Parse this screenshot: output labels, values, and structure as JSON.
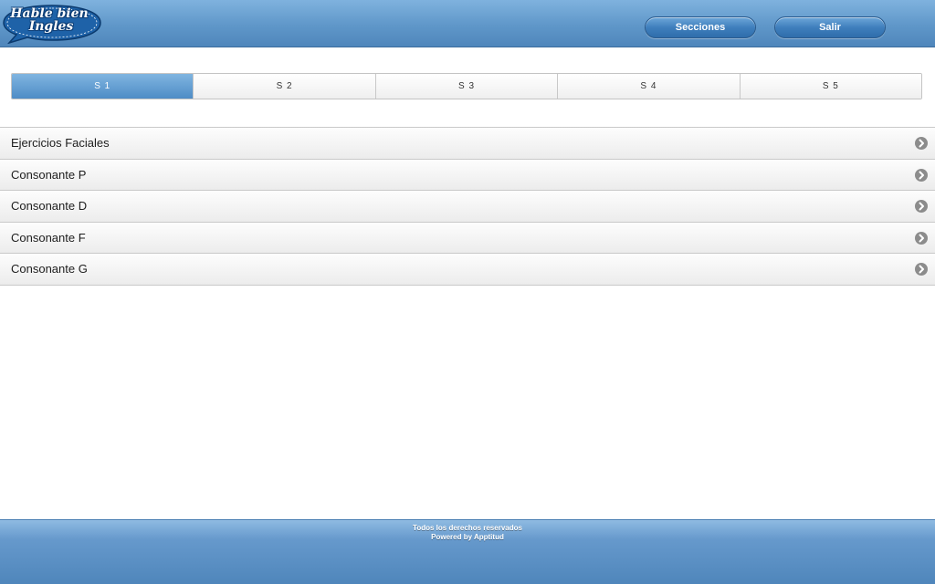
{
  "header": {
    "logo": {
      "line1": "Hable bien",
      "line2": "Ingles"
    },
    "buttons": {
      "secciones": "Secciones",
      "salir": "Salir"
    }
  },
  "tabs": {
    "items": [
      {
        "label": "S 1",
        "active": true
      },
      {
        "label": "S 2",
        "active": false
      },
      {
        "label": "S 3",
        "active": false
      },
      {
        "label": "S 4",
        "active": false
      },
      {
        "label": "S 5",
        "active": false
      }
    ]
  },
  "list": {
    "items": [
      {
        "label": "Ejercicios Faciales",
        "icon": "chevron-right-circle-icon"
      },
      {
        "label": "Consonante P",
        "icon": "chevron-right-circle-icon"
      },
      {
        "label": "Consonante D",
        "icon": "chevron-right-circle-icon"
      },
      {
        "label": "Consonante F",
        "icon": "chevron-right-circle-icon"
      },
      {
        "label": "Consonante G",
        "icon": "chevron-right-circle-icon"
      }
    ]
  },
  "footer": {
    "line1": "Todos los derechos reservados",
    "line2": "Powered by Apptitud"
  },
  "colors": {
    "header_blue": "#5f97c9",
    "active_tab": "#4e8cc6",
    "button_blue": "#3f7fbd",
    "footer_blue": "#4f86bb"
  }
}
